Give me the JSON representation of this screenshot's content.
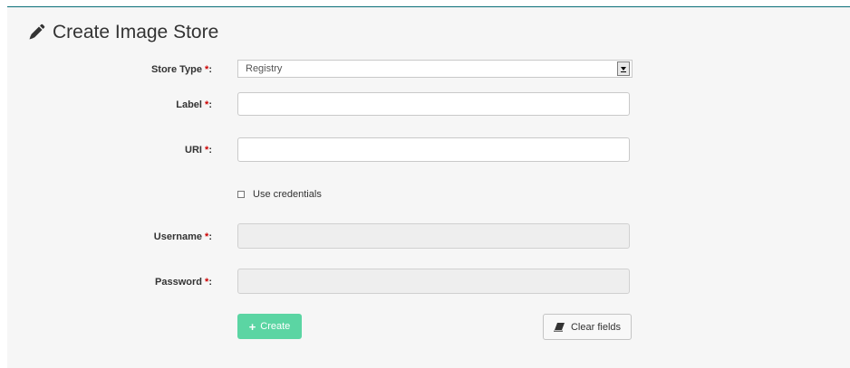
{
  "title": "Create Image Store",
  "required_marker": "*",
  "form": {
    "store_type": {
      "label": "Store Type",
      "value": "Registry"
    },
    "label_field": {
      "label": "Label",
      "value": ""
    },
    "uri_field": {
      "label": "URI",
      "value": ""
    },
    "use_credentials": {
      "label": "Use credentials",
      "checked": false
    },
    "username_field": {
      "label": "Username",
      "value": "",
      "disabled": true
    },
    "password_field": {
      "label": "Password",
      "value": "",
      "disabled": true
    }
  },
  "actions": {
    "create_label": "Create",
    "clear_label": "Clear fields"
  },
  "icons": {
    "title_icon": "pencil-icon",
    "create_icon": "plus-icon",
    "clear_icon": "eraser-icon"
  },
  "colors": {
    "accent": "#5bd5a3",
    "required": "#cc0000",
    "top_rule": "#0b6f78"
  }
}
